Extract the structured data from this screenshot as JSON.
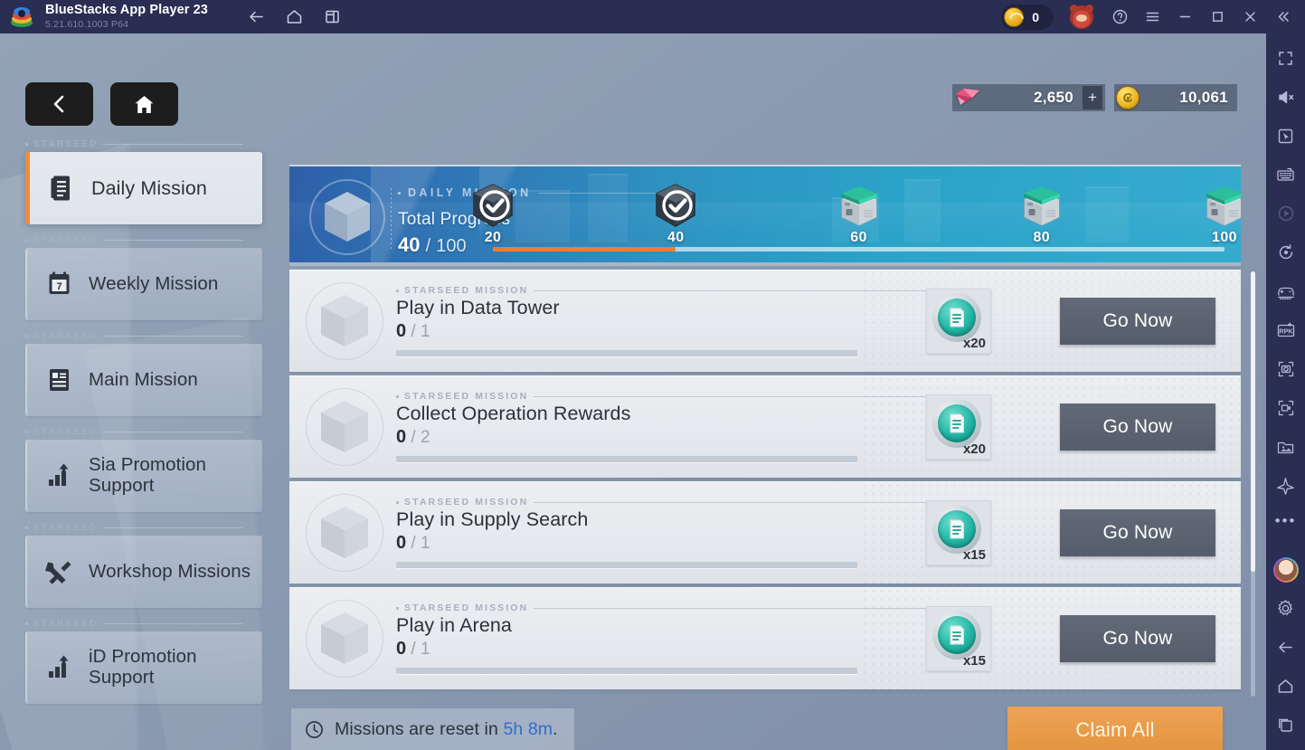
{
  "titlebar": {
    "app_title": "BlueStacks App Player 23",
    "version": "5.21.610.1003  P64",
    "nav": [
      {
        "name": "back-icon",
        "label": "Back"
      },
      {
        "name": "home-icon",
        "label": "Home"
      },
      {
        "name": "multi-instance-icon",
        "label": "Multi-instance"
      }
    ],
    "points_value": "0",
    "window_controls": [
      "help-icon",
      "menu-icon",
      "minimize-icon",
      "maximize-icon",
      "close-icon",
      "collapse-icon"
    ]
  },
  "right_toolbar": {
    "items": [
      "fullscreen-icon",
      "mute-icon",
      "cursor-icon",
      "keyboard-icon",
      "play-icon",
      "rotate-icon",
      "gamepad-icon",
      "rpk-icon",
      "screenshot-icon",
      "record-icon",
      "media-manager-icon",
      "eco-mode-icon",
      "more-icon"
    ],
    "bottom_items": [
      "profile-avatar",
      "settings-icon",
      "android-back-icon",
      "android-home-icon",
      "android-recents-icon"
    ]
  },
  "game_nav": {
    "back_label": "Back",
    "home_label": "Home"
  },
  "currency": {
    "gem_value": "2,650",
    "gem_plus": "+",
    "gold_value": "10,061"
  },
  "sidebar": {
    "group_label": "STARSEED",
    "items": [
      {
        "label": "Daily Mission",
        "icon": "list-document-icon",
        "active": true
      },
      {
        "label": "Weekly Mission",
        "icon": "calendar-7-icon",
        "active": false
      },
      {
        "label": "Main Mission",
        "icon": "main-list-icon",
        "active": false
      },
      {
        "label": "Sia Promotion Support",
        "icon": "bar-chart-up-icon",
        "active": false
      },
      {
        "label": "Workshop Missions",
        "icon": "tools-icon",
        "active": false
      },
      {
        "label": "iD Promotion Support",
        "icon": "bar-chart-up-icon",
        "active": false
      }
    ]
  },
  "banner": {
    "tag": "DAILY MISSION",
    "subtitle": "Total Progress",
    "current": "40",
    "separator": "/",
    "total": "100",
    "progress_percent": 40,
    "milestones": [
      {
        "value": "20",
        "claimed": true
      },
      {
        "value": "40",
        "claimed": true
      },
      {
        "value": "60",
        "claimed": false
      },
      {
        "value": "80",
        "claimed": false
      },
      {
        "value": "100",
        "claimed": false
      }
    ]
  },
  "missions": {
    "tag": "STARSEED MISSION",
    "action_label": "Go Now",
    "rows": [
      {
        "title": "Play in Data Tower",
        "current": "0",
        "total": "1",
        "reward_qty": "x20",
        "progress_percent": 0
      },
      {
        "title": "Collect Operation Rewards",
        "current": "0",
        "total": "2",
        "reward_qty": "x20",
        "progress_percent": 0
      },
      {
        "title": "Play in Supply Search",
        "current": "0",
        "total": "1",
        "reward_qty": "x15",
        "progress_percent": 0
      },
      {
        "title": "Play in Arena",
        "current": "0",
        "total": "1",
        "reward_qty": "x15",
        "progress_percent": 0
      }
    ]
  },
  "footer": {
    "reset_prefix": "Missions are reset in",
    "reset_time": "5h 8m",
    "reset_suffix": ".",
    "claim_all_label": "Claim All"
  },
  "colors": {
    "accent_orange": "#ef8b3c",
    "claim_orange": "#e2953f",
    "banner_blue": "#2e93c2",
    "link_blue": "#2f6fd0",
    "token_teal": "#23b5a3",
    "bg_steel": "#8b9bb1"
  }
}
